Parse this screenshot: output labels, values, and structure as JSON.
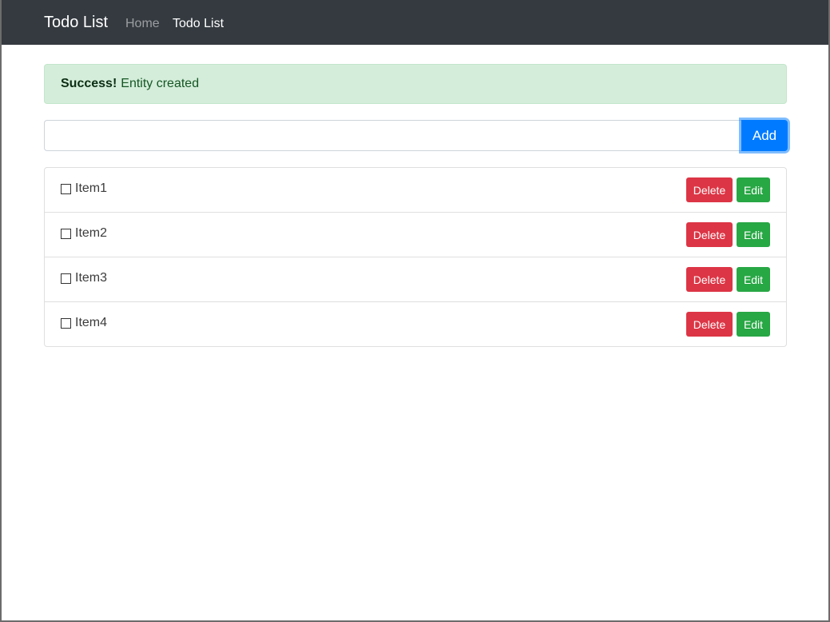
{
  "navbar": {
    "brand": "Todo List",
    "links": [
      {
        "label": "Home"
      },
      {
        "label": "Todo List"
      }
    ]
  },
  "alert": {
    "strong": "Success!",
    "message": "Entity created"
  },
  "add_form": {
    "input_value": "",
    "add_label": "Add"
  },
  "todos": [
    {
      "label": "Item1",
      "delete_label": "Delete",
      "edit_label": "Edit"
    },
    {
      "label": "Item2",
      "delete_label": "Delete",
      "edit_label": "Edit"
    },
    {
      "label": "Item3",
      "delete_label": "Delete",
      "edit_label": "Edit"
    },
    {
      "label": "Item4",
      "delete_label": "Delete",
      "edit_label": "Edit"
    }
  ],
  "colors": {
    "navbar_bg": "#343a40",
    "alert_bg": "#d4edda",
    "primary": "#007bff",
    "danger": "#dc3545",
    "success": "#28a745"
  }
}
